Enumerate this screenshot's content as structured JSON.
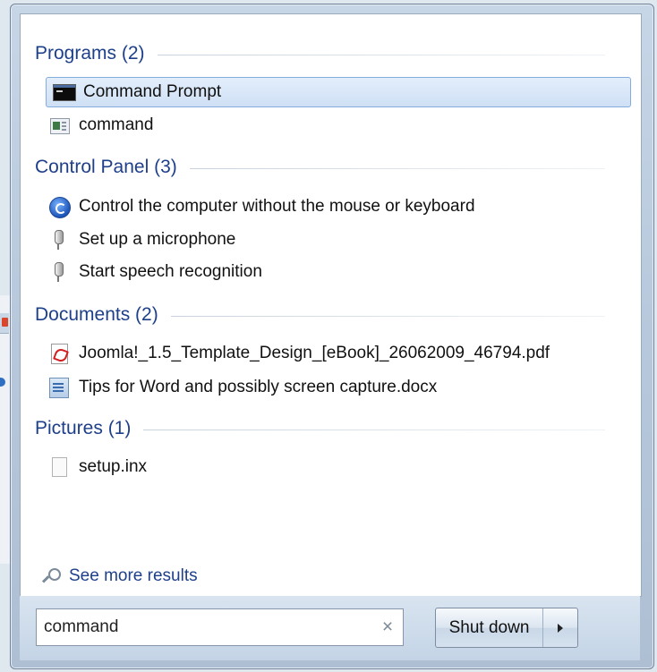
{
  "groups": {
    "programs": {
      "header": "Programs (2)",
      "items": [
        {
          "label": "Command Prompt",
          "icon": "command-prompt-icon"
        },
        {
          "label": "command",
          "icon": "application-icon"
        }
      ]
    },
    "control_panel": {
      "header": "Control Panel (3)",
      "items": [
        {
          "label": "Control the computer without the mouse or keyboard",
          "icon": "ease-of-access-icon"
        },
        {
          "label": "Set up a microphone",
          "icon": "microphone-icon"
        },
        {
          "label": "Start speech recognition",
          "icon": "microphone-icon"
        }
      ]
    },
    "documents": {
      "header": "Documents (2)",
      "items": [
        {
          "label": "Joomla!_1.5_Template_Design_[eBook]_26062009_46794.pdf",
          "icon": "pdf-icon"
        },
        {
          "label": "Tips for Word and possibly screen capture.docx",
          "icon": "word-doc-icon"
        }
      ]
    },
    "pictures": {
      "header": "Pictures (1)",
      "items": [
        {
          "label": "setup.inx",
          "icon": "file-icon"
        }
      ]
    }
  },
  "see_more": "See more results",
  "search": {
    "value": "command",
    "clear_glyph": "×"
  },
  "shutdown": {
    "label": "Shut down"
  },
  "colors": {
    "group_header": "#1e3f8a",
    "selection_border": "#84acdd",
    "link": "#1e3f8a"
  }
}
